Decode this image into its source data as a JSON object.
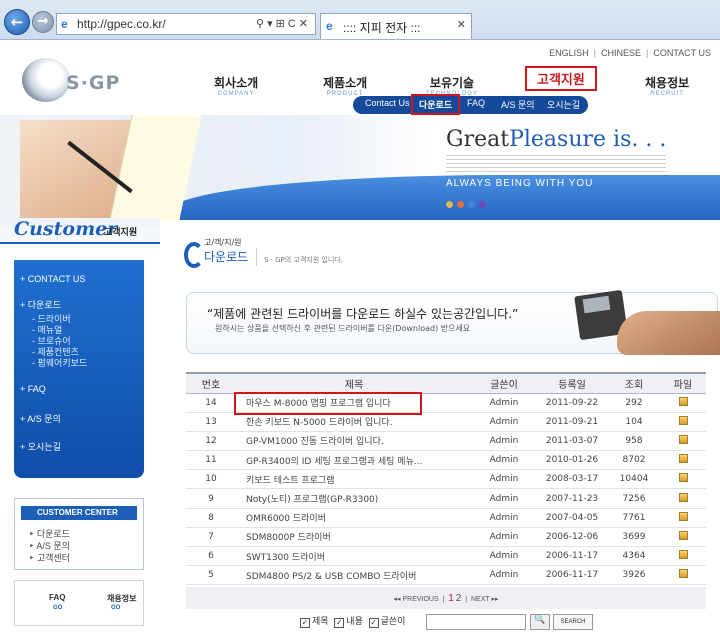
{
  "browser": {
    "url": "http://gpec.co.kr/",
    "tab_title": ":::: 지피 전자 :::"
  },
  "header": {
    "logo_text": "S·GP",
    "top_links": [
      "ENGLISH",
      "CHINESE",
      "CONTACT US"
    ],
    "menu": [
      {
        "ko": "회사소개",
        "en": "COMPANY"
      },
      {
        "ko": "제품소개",
        "en": "PRODUCT"
      },
      {
        "ko": "보유기술",
        "en": "TECHNOLOGY"
      },
      {
        "ko": "고객지원",
        "en": ""
      },
      {
        "ko": "채용정보",
        "en": "RECRUIT"
      }
    ],
    "submenu": [
      "Contact Us",
      "다운로드",
      "FAQ",
      "A/S 문의",
      "오시는길"
    ]
  },
  "banner": {
    "great": "Great",
    "pleasure": "Pleasure is. . .",
    "always": "ALWAYS BEING WITH  YOU",
    "dot_colors": [
      "#e8b64a",
      "#e46f3c",
      "#4e7fd6",
      "#6b4bb5"
    ]
  },
  "sidebar": {
    "title_en": "Customer",
    "title_ko": "고객지원",
    "nav": [
      {
        "label": "CONTACT US"
      },
      {
        "label": "다운로드"
      },
      {
        "label": "FAQ"
      },
      {
        "label": "A/S 문의"
      },
      {
        "label": "오시는길"
      }
    ],
    "subnav": [
      "드라이버",
      "매뉴얼",
      "브로슈어",
      "제품컨텐츠",
      "펌웨어키보드"
    ],
    "center_title": "CUSTOMER CENTER",
    "center_items": [
      "다운로드",
      "A/S 문의",
      "고객센터"
    ],
    "quick": {
      "faq": "FAQ",
      "faq_go": "GO",
      "recruit": "채용정보",
      "recruit_go": "GO"
    }
  },
  "main": {
    "crumb_small": "고/객/지/원",
    "crumb_big": "다운로드",
    "crumb_desc": "S · GP의 고객지원 입니다.",
    "notice_main": "“제품에 관련된 드라이버를 다운로드 하실수 있는공간입니다.”",
    "notice_sub": "원하시는 상품을 선택하신 후 관련된 드라이버를 다운(Download) 받으세요",
    "columns": [
      "번호",
      "제목",
      "글쓴이",
      "등록일",
      "조회",
      "파일"
    ],
    "rows": [
      {
        "no": "14",
        "title": "마우스 M-8000 맵핑 프로그램 입니다",
        "author": "Admin",
        "date": "2011-09-22",
        "views": "292"
      },
      {
        "no": "13",
        "title": "한손 키보드 N-5000 드라이버 입니다.",
        "author": "Admin",
        "date": "2011-09-21",
        "views": "104"
      },
      {
        "no": "12",
        "title": "GP-VM1000 진동 드라이버 입니다.",
        "author": "Admin",
        "date": "2011-03-07",
        "views": "958"
      },
      {
        "no": "11",
        "title": "GP-R3400의 ID 세팅 프로그램과 세팅 메뉴...",
        "author": "Admin",
        "date": "2010-01-26",
        "views": "8702"
      },
      {
        "no": "10",
        "title": "키보드 테스트 프로그램",
        "author": "Admin",
        "date": "2008-03-17",
        "views": "10404"
      },
      {
        "no": "9",
        "title": "Noty(노티) 프로그램(GP-R3300)",
        "author": "Admin",
        "date": "2007-11-23",
        "views": "7256"
      },
      {
        "no": "8",
        "title": "OMR6000 드라이버",
        "author": "Admin",
        "date": "2007-04-05",
        "views": "7761"
      },
      {
        "no": "7",
        "title": "SDM8000P 드라이버",
        "author": "Admin",
        "date": "2006-12-06",
        "views": "3699"
      },
      {
        "no": "6",
        "title": "SWT1300 드라이버",
        "author": "Admin",
        "date": "2006-11-17",
        "views": "4364"
      },
      {
        "no": "5",
        "title": "SDM4800 PS/2 & USB COMBO 드라이버",
        "author": "Admin",
        "date": "2006-11-17",
        "views": "3926"
      }
    ],
    "pager": {
      "prev": "PREVIOUS",
      "page1": "1",
      "page2": "2",
      "next": "NEXT"
    },
    "search": {
      "opt1": "제목",
      "opt2": "내용",
      "opt3": "글쓴이",
      "btn": "SEARCH"
    }
  }
}
